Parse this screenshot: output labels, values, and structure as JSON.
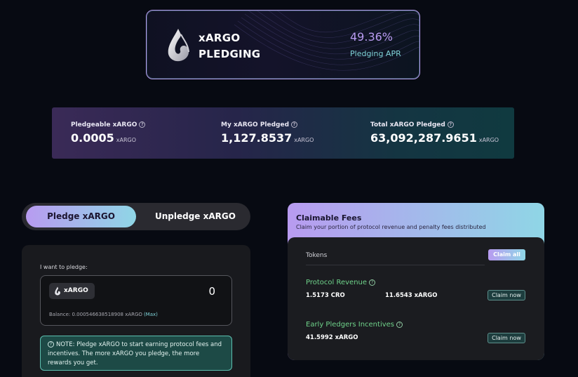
{
  "hero": {
    "title_line1": "xARGO",
    "title_line2": "PLEDGING",
    "apr_value": "49.36%",
    "apr_label": "Pledging APR"
  },
  "stats": [
    {
      "label": "Pledgeable xARGO",
      "value": "0.0005",
      "unit": "xARGO"
    },
    {
      "label": "My xARGO Pledged",
      "value": "1,127.8537",
      "unit": "xARGO"
    },
    {
      "label": "Total xARGO Pledged",
      "value": "63,092,287.9651",
      "unit": "xARGO"
    }
  ],
  "toggle": {
    "pledge_label": "Pledge xARGO",
    "unpledge_label": "Unpledge xARGO",
    "active": "pledge"
  },
  "pledge_form": {
    "label": "I want to pledge:",
    "token": "xARGO",
    "amount_value": "0",
    "balance_text": "Balance: 0.000546638518908 xARGO",
    "max_label": "(Max)",
    "note": "NOTE: Pledge xARGO to start earning protocol fees and incentives. The more xARGO you pledge, the more rewards you get."
  },
  "fees": {
    "title": "Claimable Fees",
    "subtitle": "Claim your portion of protocol revenue and penalty fees distributed",
    "tokens_label": "Tokens",
    "claim_all_label": "Claim all",
    "protocol_revenue": {
      "title": "Protocol Revenue",
      "value1": "1.5173 CRO",
      "value2": "11.6543 xARGO",
      "claim_label": "Claim now"
    },
    "early_pledgers": {
      "title": "Early Pledgers Incentives",
      "value1": "41.5992 xARGO",
      "claim_label": "Claim now"
    }
  },
  "colors": {
    "accent_purple": "#b89bf0",
    "accent_cyan": "#8fd6e6",
    "green_text": "#6fd38a",
    "background": "#070a12"
  }
}
